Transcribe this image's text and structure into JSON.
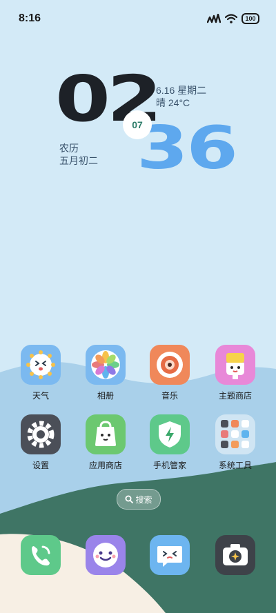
{
  "status_bar": {
    "time": "8:16",
    "battery": "100"
  },
  "clock": {
    "hours": "02",
    "minutes": "36",
    "seconds": "07"
  },
  "date": {
    "line1": "6.16  星期二",
    "line2": "晴 24°C"
  },
  "lunar": {
    "line1": "农历",
    "line2": "五月初二"
  },
  "apps": [
    {
      "label": "天气",
      "icon": "weather-icon"
    },
    {
      "label": "相册",
      "icon": "gallery-icon"
    },
    {
      "label": "音乐",
      "icon": "music-icon"
    },
    {
      "label": "主题商店",
      "icon": "theme-store-icon"
    },
    {
      "label": "设置",
      "icon": "settings-icon"
    },
    {
      "label": "应用商店",
      "icon": "app-store-icon"
    },
    {
      "label": "手机管家",
      "icon": "phone-manager-icon"
    },
    {
      "label": "系统工具",
      "icon": "system-tools-folder-icon"
    }
  ],
  "search": {
    "label": "搜索"
  },
  "dock": [
    {
      "icon": "phone-icon"
    },
    {
      "icon": "browser-icon"
    },
    {
      "icon": "messages-icon"
    },
    {
      "icon": "camera-icon"
    }
  ],
  "colors": {
    "sky": "#d3eaf7",
    "hill_blue": "#a9d0ea",
    "hill_green": "#3f7565",
    "sand": "#f7efe4",
    "minute_blue": "#5ea8ee"
  }
}
